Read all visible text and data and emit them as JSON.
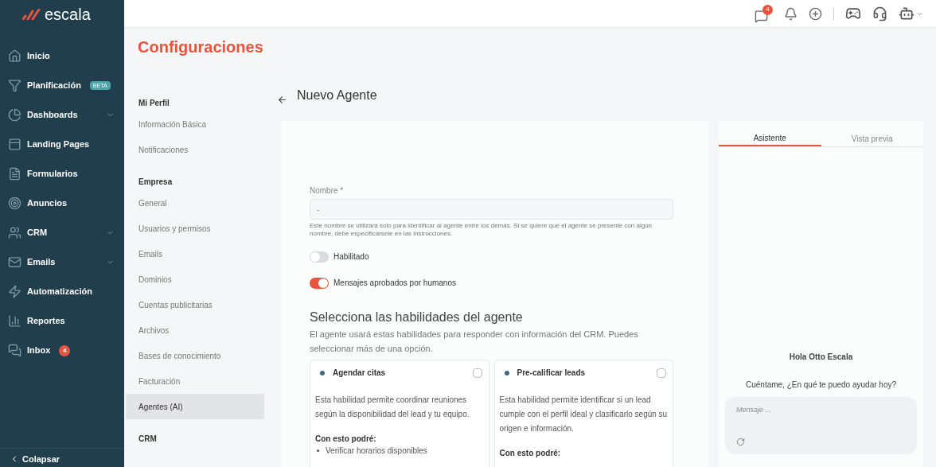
{
  "brand": {
    "name": "escala"
  },
  "sidebar": {
    "items": [
      {
        "label": "Inicio",
        "expandable": false
      },
      {
        "label": "Planificación",
        "badge": "BETA",
        "expandable": false
      },
      {
        "label": "Dashboards",
        "expandable": true
      },
      {
        "label": "Landing Pages",
        "expandable": false
      },
      {
        "label": "Formularios",
        "expandable": false
      },
      {
        "label": "Anuncios",
        "expandable": false
      },
      {
        "label": "CRM",
        "expandable": true
      },
      {
        "label": "Emails",
        "expandable": true
      },
      {
        "label": "Automatización",
        "expandable": false
      },
      {
        "label": "Reportes",
        "expandable": false
      },
      {
        "label": "Inbox",
        "badge": "4",
        "expandable": false
      }
    ],
    "collapse": "Colapsar"
  },
  "topbar": {
    "messages_badge": "4"
  },
  "page_title": "Configuraciones",
  "settings_nav": [
    {
      "title": "Mi Perfil",
      "items": [
        {
          "label": "Información Básica",
          "selected": false
        },
        {
          "label": "Notificaciones",
          "selected": false
        }
      ]
    },
    {
      "title": "Empresa",
      "items": [
        {
          "label": "General",
          "selected": false
        },
        {
          "label": "Usuarios y permisos",
          "selected": false
        },
        {
          "label": "Emails",
          "selected": false
        },
        {
          "label": "Dominios",
          "selected": false
        },
        {
          "label": "Cuentas publicitarias",
          "selected": false
        },
        {
          "label": "Archivos",
          "selected": false
        },
        {
          "label": "Bases de conocimiento",
          "selected": false
        },
        {
          "label": "Facturación",
          "selected": false
        },
        {
          "label": "Agentes (AI)",
          "selected": true
        }
      ]
    },
    {
      "title": "CRM"
    }
  ],
  "heading": "Nuevo Agente",
  "form": {
    "name_label": "Nombre *",
    "name_value": "-",
    "name_help": "Este nombre se utilizará solo para identificar al agente entre los demás. Si se quiere que el agente se presente con algún nombre, debe especificársele en las instrucciones.",
    "toggles": [
      {
        "label": "Habilitado",
        "on": false
      },
      {
        "label": "Mensajes aprobados por humanos",
        "on": true
      }
    ],
    "skills_title": "Selecciona las habilidades del agente",
    "skills_description": "El agente usará estas habilidades para responder con información del CRM. Puedes seleccionar más de una opción.",
    "skills": [
      {
        "title": "Agendar citas",
        "checked": false,
        "description": "Esta habilidad permite coordinar reuniones según la disponibilidad del lead y tu equipo.",
        "list_title": "Con esto podré:",
        "list": [
          "Verificar horarios disponibles"
        ]
      },
      {
        "title": "Pre-calificar leads",
        "checked": false,
        "description": "Esta habilidad permite identificar si un lead cumple con el perfil ideal y clasificarlo según su origen e información.",
        "list_title": "Con esto podré:"
      }
    ]
  },
  "chat": {
    "tabs": [
      {
        "label": "Asistente",
        "selected": true
      },
      {
        "label": "Vista previa",
        "selected": false
      }
    ],
    "greeting": "Hola Otto Escala",
    "prompt": "Cuéntame, ¿En qué te puedo ayudar hoy?",
    "placeholder": "Mensaje ..."
  }
}
